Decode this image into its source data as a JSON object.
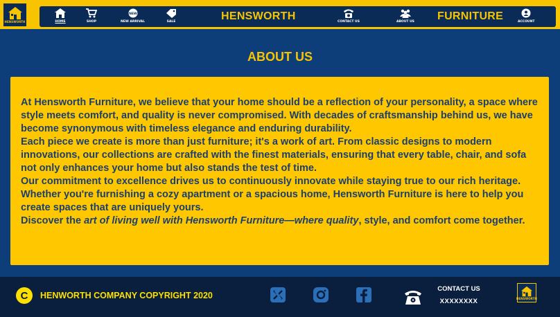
{
  "logo": {
    "text": "HENSWORTH",
    "icon": "house-icon"
  },
  "nav": {
    "items": [
      {
        "label": "HOME",
        "icon": "home-icon",
        "active": true
      },
      {
        "label": "SHOP",
        "icon": "cart-icon"
      },
      {
        "label": "NEW ARRIVAL",
        "icon": "new-badge-icon"
      },
      {
        "label": "SALE",
        "icon": "tag-icon"
      },
      {
        "label": "CONTACT US",
        "icon": "phone-icon"
      },
      {
        "label": "ABOUT US",
        "icon": "people-icon"
      },
      {
        "label": "ACCOUNT",
        "icon": "user-icon"
      }
    ],
    "brand_left": "HENSWORTH",
    "brand_right": "FURNITURE"
  },
  "page": {
    "title": "ABOUT US"
  },
  "about": {
    "p1": "At Hensworth Furniture, we believe that your home should be a reflection of your personality, a space where style meets comfort, and quality is never compromised. With decades of craftsmanship behind us, we have become synonymous with timeless elegance and enduring durability.",
    "p2": "Each piece we create is more than just furniture; it's a work of art. From classic designs to modern innovations, our collections are crafted with the finest materials, ensuring that every table, chair, and sofa not only enhances your home but also stands the test of time.",
    "p3": "Our commitment to excellence drives us to continuously innovate while staying true to our rich heritage. Whether you're furnishing a cozy apartment or a spacious home, Hensworth Furniture is here to help you create spaces that are uniquely yours.",
    "p4_start": "Discover the ",
    "p4_em": "art of living well with Hensworth Furniture—where quality",
    "p4_end": ", style, and comfort come together."
  },
  "footer": {
    "copyright_symbol": "C",
    "copyright": "HENWORTH COMPANY COPYRIGHT 2020",
    "social": [
      "x-icon",
      "instagram-icon",
      "facebook-icon"
    ],
    "contact_label": "CONTACT US",
    "contact_value": "XXXXXXXX"
  },
  "colors": {
    "yellow": "#f8c400",
    "navy": "#0b2b57",
    "background": "#0d3e7a",
    "text_blue": "#1c3f72",
    "footer_bg": "#0a1e3d"
  }
}
